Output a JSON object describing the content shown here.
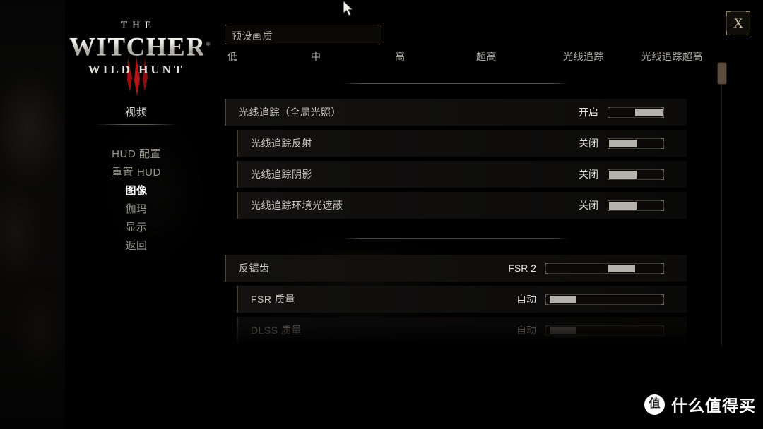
{
  "window": {
    "close_label": "X"
  },
  "logo": {
    "line1": "THE",
    "line2": "WITCHER",
    "registered": "®",
    "line3": "WILD HUNT"
  },
  "sidebar": {
    "title": "视频",
    "items": [
      {
        "label": "HUD 配置",
        "selected": false
      },
      {
        "label": "重置 HUD",
        "selected": false
      },
      {
        "label": "图像",
        "selected": true
      },
      {
        "label": "伽玛",
        "selected": false
      },
      {
        "label": "显示",
        "selected": false
      },
      {
        "label": "返回",
        "selected": false
      }
    ]
  },
  "preset": {
    "label": "预设画质",
    "tabs": [
      {
        "label": "低"
      },
      {
        "label": "中"
      },
      {
        "label": "高"
      },
      {
        "label": "超高"
      },
      {
        "label": "光线追踪"
      },
      {
        "label": "光线追踪超高"
      }
    ]
  },
  "settings": {
    "groups": [
      {
        "rows": [
          {
            "label": "光线追踪（全局光照）",
            "value": "开启",
            "control": "toggle",
            "state": "on",
            "level": "parent",
            "disabled": false
          },
          {
            "label": "光线追踪反射",
            "value": "关闭",
            "control": "toggle",
            "state": "off",
            "level": "child",
            "disabled": false
          },
          {
            "label": "光线追踪阴影",
            "value": "关闭",
            "control": "toggle",
            "state": "off",
            "level": "child",
            "disabled": false
          },
          {
            "label": "光线追踪环境光遮蔽",
            "value": "关闭",
            "control": "toggle",
            "state": "off",
            "level": "child",
            "disabled": false
          }
        ]
      },
      {
        "rows": [
          {
            "label": "反锯齿",
            "value": "FSR 2",
            "control": "slider",
            "fill": 68,
            "level": "parent",
            "disabled": false
          },
          {
            "label": "FSR 质量",
            "value": "自动",
            "control": "slider",
            "fill": 3,
            "level": "child",
            "disabled": false
          },
          {
            "label": "DLSS 质量",
            "value": "自动",
            "control": "slider",
            "fill": 3,
            "level": "child",
            "disabled": true
          }
        ]
      }
    ]
  },
  "scrollbar": {
    "position_percent": 0
  },
  "watermark": {
    "badge": "值",
    "text": "什么值得买"
  },
  "colors": {
    "accent_bar": "#4b4034",
    "scroll_thumb": "#5b4c3e",
    "close_icon": "#cdbf9e",
    "thumb": "#b5b2ab",
    "claw_red": "#a11212"
  }
}
